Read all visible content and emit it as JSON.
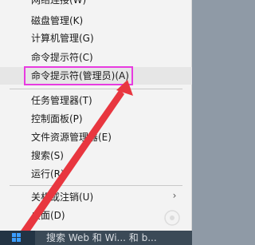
{
  "menu": {
    "items": [
      {
        "label": "网络连接(W)"
      },
      {
        "label": "磁盘管理(K)"
      },
      {
        "label": "计算机管理(G)"
      },
      {
        "label": "命令提示符(C)"
      },
      {
        "label": "命令提示符(管理员)(A)"
      },
      {
        "label": "任务管理器(T)"
      },
      {
        "label": "控制面板(P)"
      },
      {
        "label": "文件资源管理器(E)"
      },
      {
        "label": "搜索(S)"
      },
      {
        "label": "运行(R)"
      },
      {
        "label": "关机或注销(U)"
      },
      {
        "label": "桌面(D)"
      }
    ],
    "submenu_indicator": "›"
  },
  "annotation": {
    "highlight_color": "#e83be0",
    "arrow_color": "#e8363f"
  },
  "taskbar": {
    "search_text": "搜索 Web 和 Wi... 和 b...",
    "start_icon": "windows-logo-icon"
  }
}
